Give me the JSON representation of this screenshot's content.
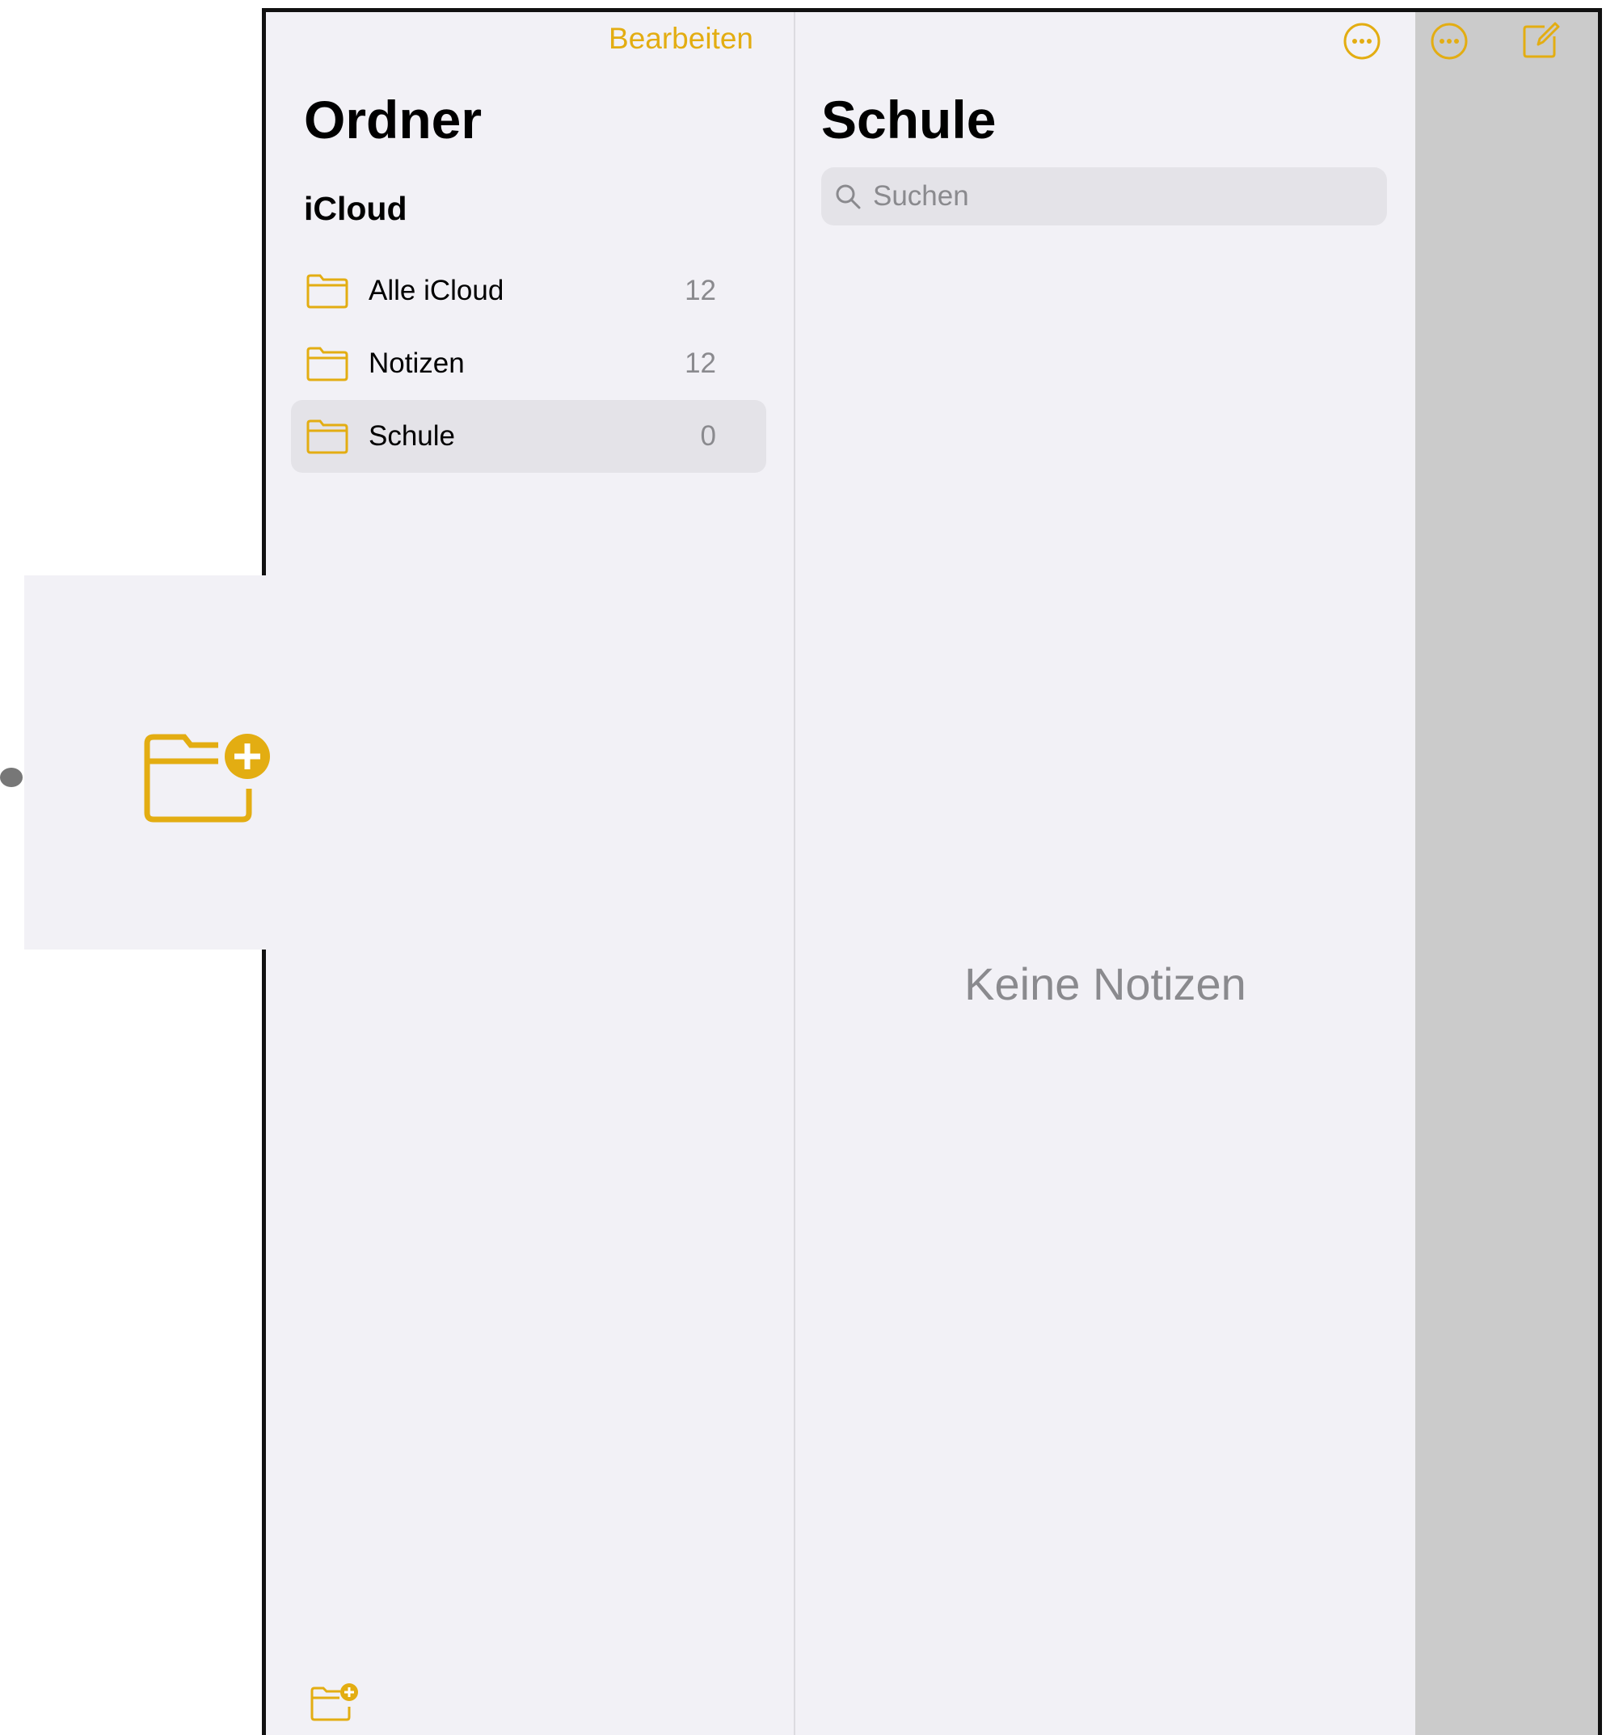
{
  "sidebar": {
    "edit_label": "Bearbeiten",
    "title": "Ordner",
    "section": "iCloud",
    "folders": [
      {
        "label": "Alle iCloud",
        "count": "12",
        "selected": false
      },
      {
        "label": "Notizen",
        "count": "12",
        "selected": false
      },
      {
        "label": "Schule",
        "count": "0",
        "selected": true
      }
    ]
  },
  "notes": {
    "title": "Schule",
    "search_placeholder": "Suchen",
    "empty_text": "Keine Notizen"
  },
  "colors": {
    "accent": "#e3ad12",
    "background": "#f2f1f6",
    "selected_row": "#e4e3e8",
    "secondary_text": "#8a8a8e",
    "detail_pane": "#cbcbcb"
  },
  "icons": {
    "folder": "folder-icon",
    "new_folder": "new-folder-icon",
    "more": "ellipsis-circle-icon",
    "compose": "compose-icon",
    "search": "search-icon"
  }
}
